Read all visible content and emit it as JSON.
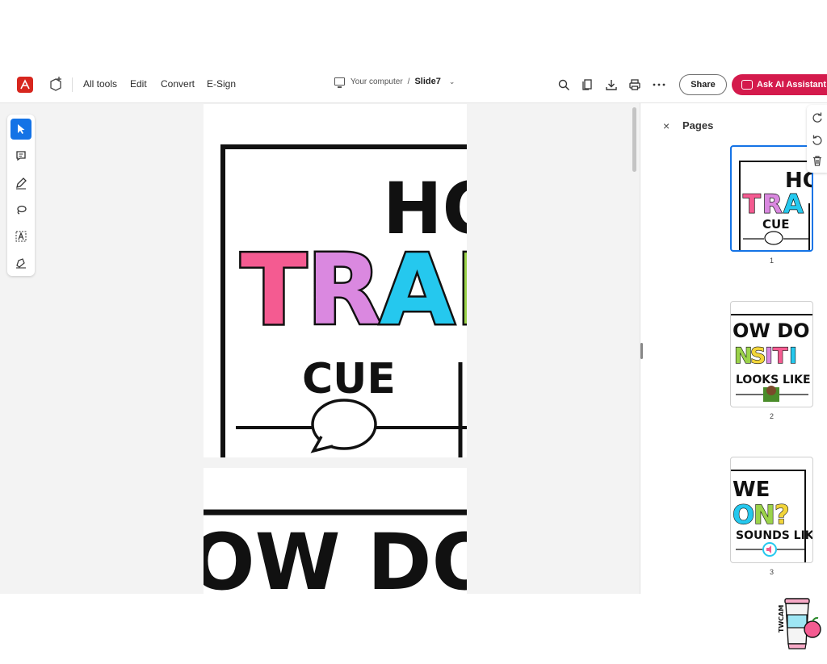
{
  "toolbar": {
    "logo_text": "A",
    "menus": [
      "All tools",
      "Edit",
      "Convert",
      "E-Sign"
    ],
    "location": "Your computer",
    "separator": "/",
    "file_name": "Slide7",
    "share_label": "Share",
    "ai_label": "Ask AI Assistant",
    "icons": [
      "add-tool-icon",
      "search-icon",
      "page-view-icon",
      "download-icon",
      "print-icon",
      "more-icon"
    ]
  },
  "left_tools": [
    "select-tool-icon",
    "comment-tool-icon",
    "draw-tool-icon",
    "lasso-tool-icon",
    "text-select-tool-icon",
    "sign-tool-icon"
  ],
  "page1": {
    "line1": "HO",
    "line2": [
      "T",
      "R",
      "A",
      "N"
    ],
    "cue": "CUE"
  },
  "page2": {
    "line1": "OW DO V"
  },
  "pages_panel": {
    "close": "×",
    "title": "Pages",
    "thumbnails": [
      {
        "number": "1",
        "line1": "HO",
        "line2": "TRA",
        "line3": "CUE"
      },
      {
        "number": "2",
        "line1": "OW DO V",
        "line2": "NSITI",
        "line3": "LOOKS LIKE"
      },
      {
        "number": "3",
        "line1": "WE",
        "line2": "ON?",
        "line3": "SOUNDS LIKE"
      }
    ]
  },
  "brand": {
    "mark": "TWCAM"
  },
  "colors": {
    "pink": "#f45b91",
    "purple": "#da88e0",
    "cyan": "#25c8ee",
    "green": "#9bd34a",
    "yellow": "#f2d53a",
    "accent": "#1473e6",
    "ai": "#d41a4c",
    "adobe_red": "#d7261e"
  }
}
